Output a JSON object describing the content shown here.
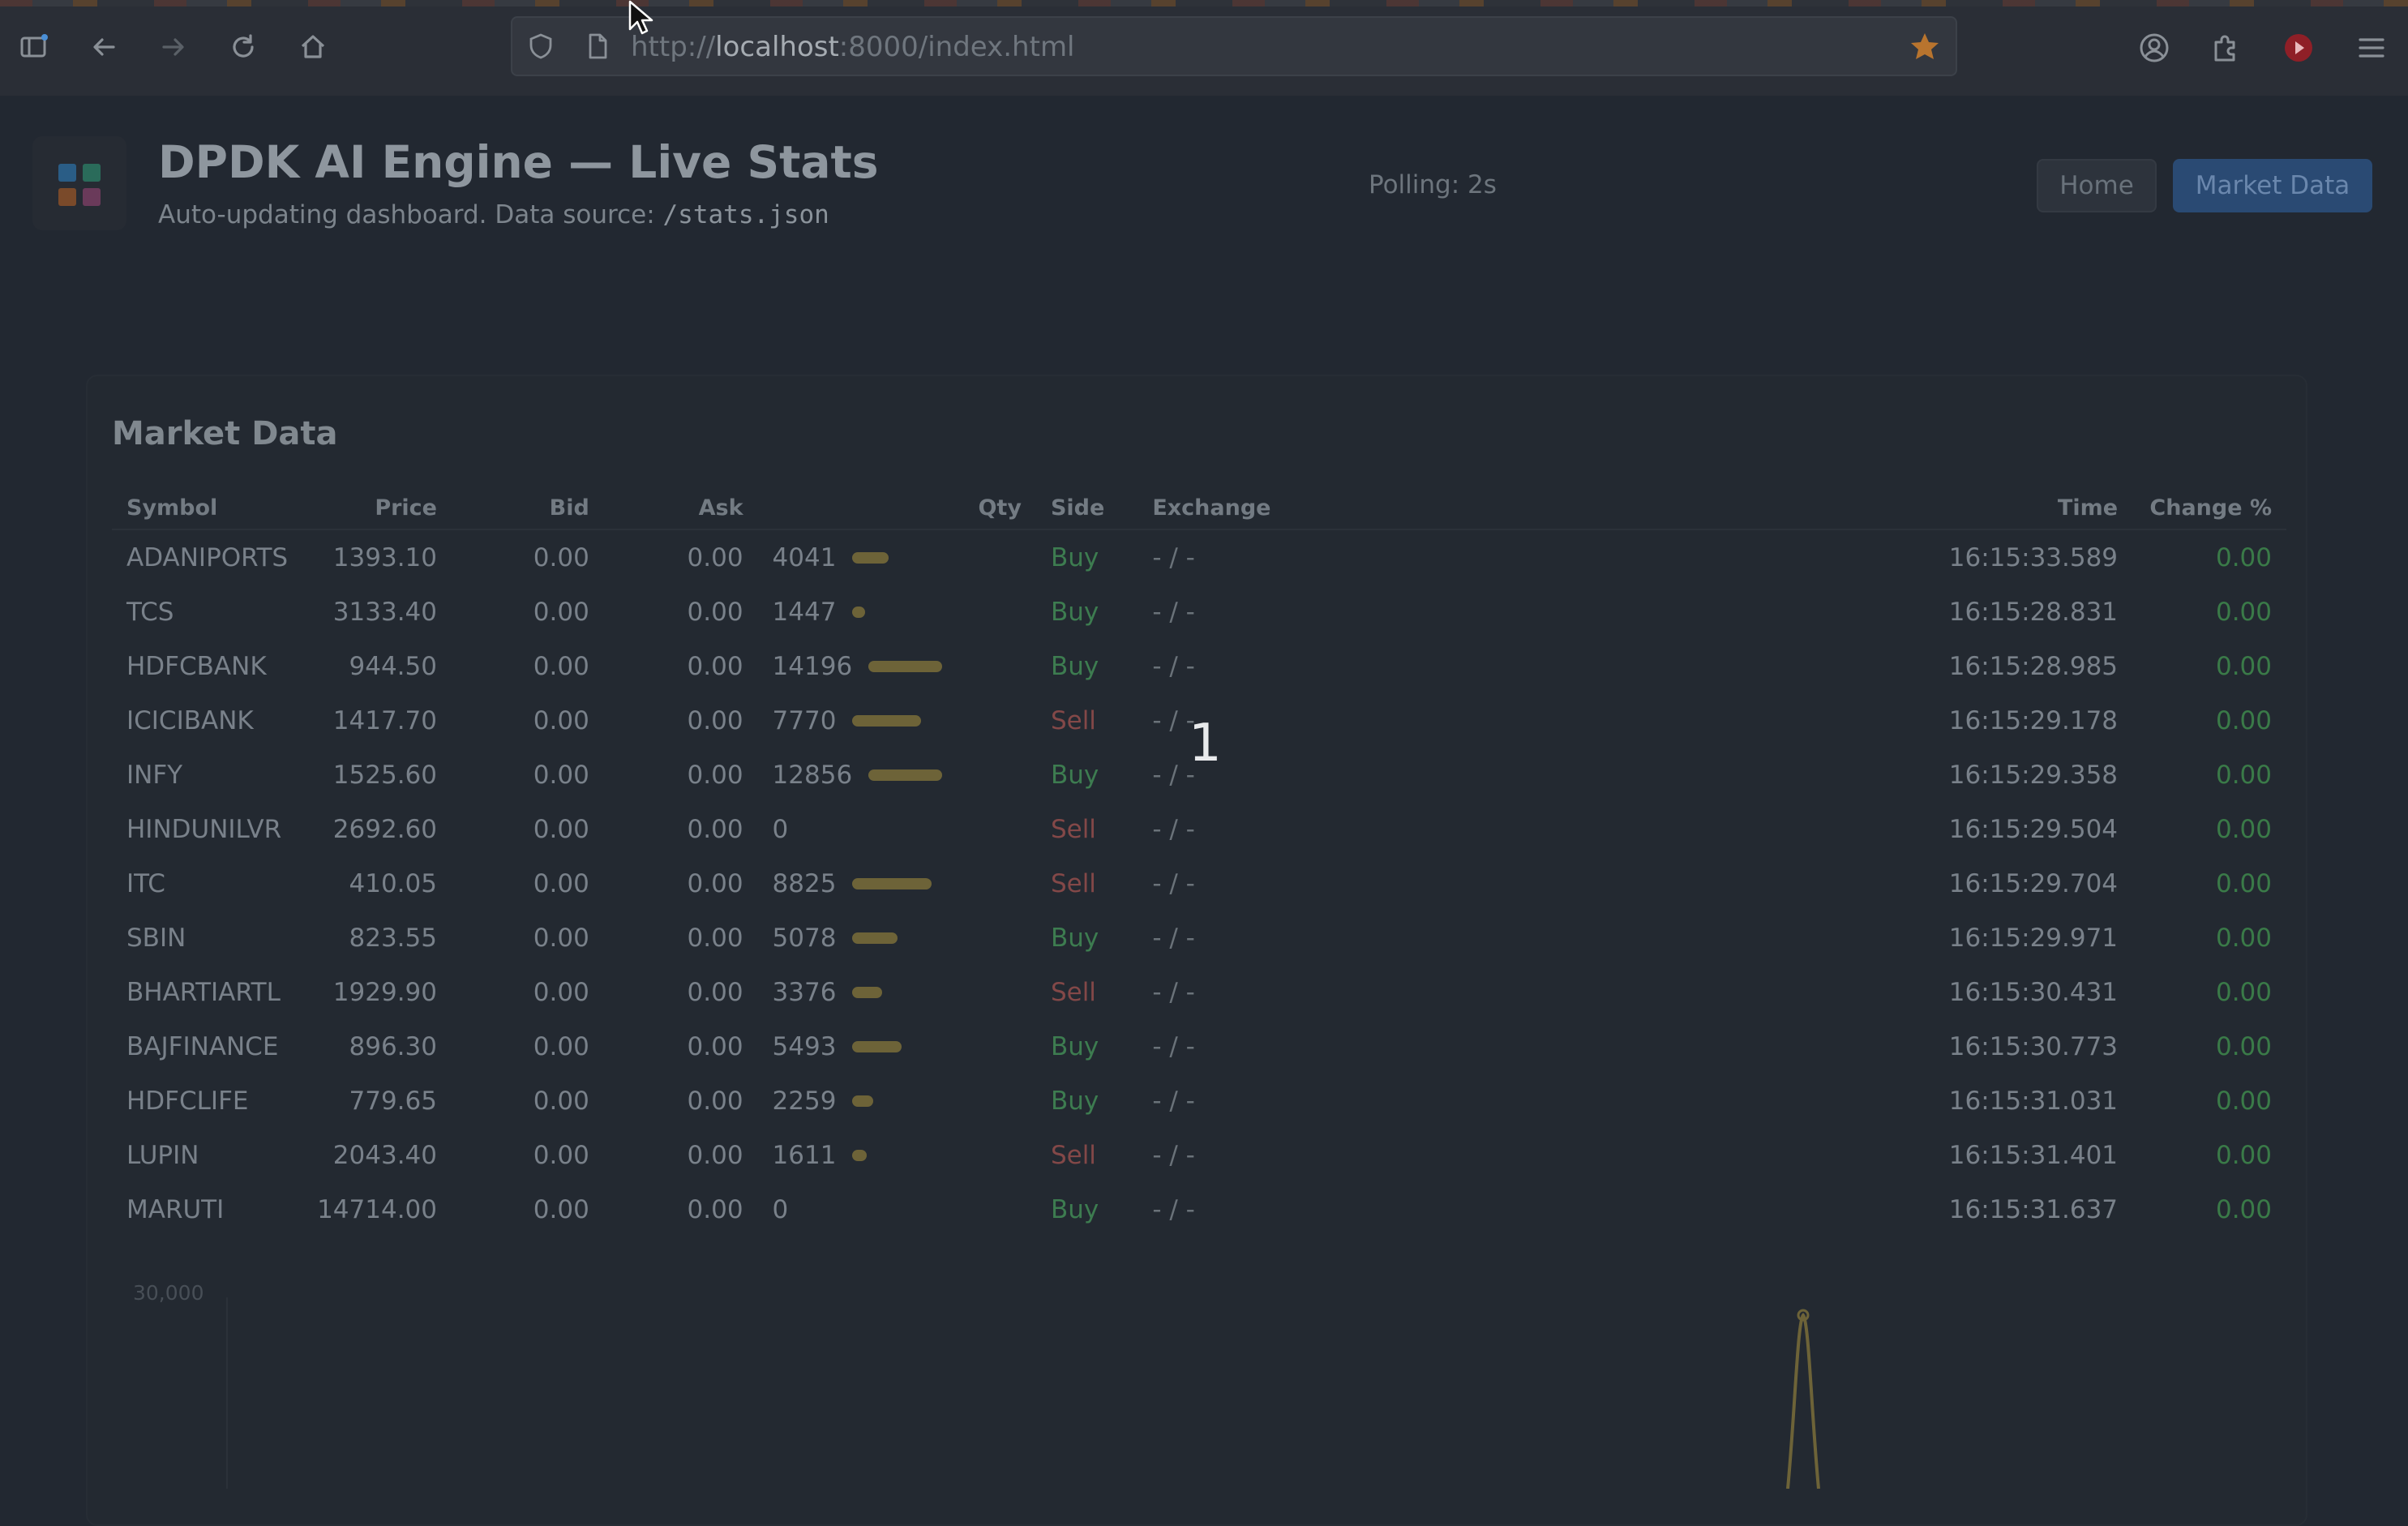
{
  "browser": {
    "url_scheme": "http://",
    "url_host": "localhost",
    "url_path": ":8000/index.html"
  },
  "header": {
    "title": "DPDK AI Engine — Live Stats",
    "subtitle_prefix": "Auto-updating dashboard. Data source: ",
    "subtitle_source": "/stats.json",
    "polling": "Polling: 2s",
    "nav": {
      "home": "Home",
      "market_data": "Market Data"
    }
  },
  "market": {
    "title": "Market Data",
    "columns": [
      "Symbol",
      "Price",
      "Bid",
      "Ask",
      "Qty",
      "Side",
      "Exchange",
      "Time",
      "Change %"
    ],
    "rows": [
      {
        "symbol": "ADANIPORTS",
        "price": "1393.10",
        "bid": "0.00",
        "ask": "0.00",
        "qty": "4041",
        "qty_fill": 0.28,
        "side": "Buy",
        "exchange": "- / -",
        "time": "16:15:33.589",
        "change": "0.00"
      },
      {
        "symbol": "TCS",
        "price": "3133.40",
        "bid": "0.00",
        "ask": "0.00",
        "qty": "1447",
        "qty_fill": 0.1,
        "side": "Buy",
        "exchange": "- / -",
        "time": "16:15:28.831",
        "change": "0.00"
      },
      {
        "symbol": "HDFCBANK",
        "price": "944.50",
        "bid": "0.00",
        "ask": "0.00",
        "qty": "14196",
        "qty_fill": 0.57,
        "side": "Buy",
        "exchange": "- / -",
        "time": "16:15:28.985",
        "change": "0.00"
      },
      {
        "symbol": "ICICIBANK",
        "price": "1417.70",
        "bid": "0.00",
        "ask": "0.00",
        "qty": "7770",
        "qty_fill": 0.53,
        "side": "Sell",
        "exchange": "- / -",
        "time": "16:15:29.178",
        "change": "0.00"
      },
      {
        "symbol": "INFY",
        "price": "1525.60",
        "bid": "0.00",
        "ask": "0.00",
        "qty": "12856",
        "qty_fill": 0.57,
        "side": "Buy",
        "exchange": "- / -",
        "time": "16:15:29.358",
        "change": "0.00"
      },
      {
        "symbol": "HINDUNILVR",
        "price": "2692.60",
        "bid": "0.00",
        "ask": "0.00",
        "qty": "0",
        "qty_fill": 0,
        "side": "Sell",
        "exchange": "- / -",
        "time": "16:15:29.504",
        "change": "0.00"
      },
      {
        "symbol": "ITC",
        "price": "410.05",
        "bid": "0.00",
        "ask": "0.00",
        "qty": "8825",
        "qty_fill": 0.61,
        "side": "Sell",
        "exchange": "- / -",
        "time": "16:15:29.704",
        "change": "0.00"
      },
      {
        "symbol": "SBIN",
        "price": "823.55",
        "bid": "0.00",
        "ask": "0.00",
        "qty": "5078",
        "qty_fill": 0.35,
        "side": "Buy",
        "exchange": "- / -",
        "time": "16:15:29.971",
        "change": "0.00"
      },
      {
        "symbol": "BHARTIARTL",
        "price": "1929.90",
        "bid": "0.00",
        "ask": "0.00",
        "qty": "3376",
        "qty_fill": 0.23,
        "side": "Sell",
        "exchange": "- / -",
        "time": "16:15:30.431",
        "change": "0.00"
      },
      {
        "symbol": "BAJFINANCE",
        "price": "896.30",
        "bid": "0.00",
        "ask": "0.00",
        "qty": "5493",
        "qty_fill": 0.38,
        "side": "Buy",
        "exchange": "- / -",
        "time": "16:15:30.773",
        "change": "0.00"
      },
      {
        "symbol": "HDFCLIFE",
        "price": "779.65",
        "bid": "0.00",
        "ask": "0.00",
        "qty": "2259",
        "qty_fill": 0.16,
        "side": "Buy",
        "exchange": "- / -",
        "time": "16:15:31.031",
        "change": "0.00"
      },
      {
        "symbol": "LUPIN",
        "price": "2043.40",
        "bid": "0.00",
        "ask": "0.00",
        "qty": "1611",
        "qty_fill": 0.11,
        "side": "Sell",
        "exchange": "- / -",
        "time": "16:15:31.401",
        "change": "0.00"
      },
      {
        "symbol": "MARUTI",
        "price": "14714.00",
        "bid": "0.00",
        "ask": "0.00",
        "qty": "0",
        "qty_fill": 0,
        "side": "Buy",
        "exchange": "- / -",
        "time": "16:15:31.637",
        "change": "0.00"
      }
    ]
  },
  "overlay_number": "1",
  "chart_data": {
    "type": "line",
    "y_tick_labels": [
      "30,000"
    ],
    "ylim": [
      0,
      30000
    ]
  },
  "colors": {
    "buy": "#3d7c50",
    "sell": "#834848",
    "qty_bar": "#6d6338",
    "accent": "#2a4a73"
  },
  "icons": [
    "sidebar-icon",
    "back-icon",
    "forward-icon",
    "reload-icon",
    "home-icon",
    "shield-icon",
    "page-icon",
    "bookmark-star-icon",
    "account-icon",
    "extensions-icon",
    "record-icon",
    "menu-icon",
    "cursor-icon",
    "app-logo-icon"
  ]
}
